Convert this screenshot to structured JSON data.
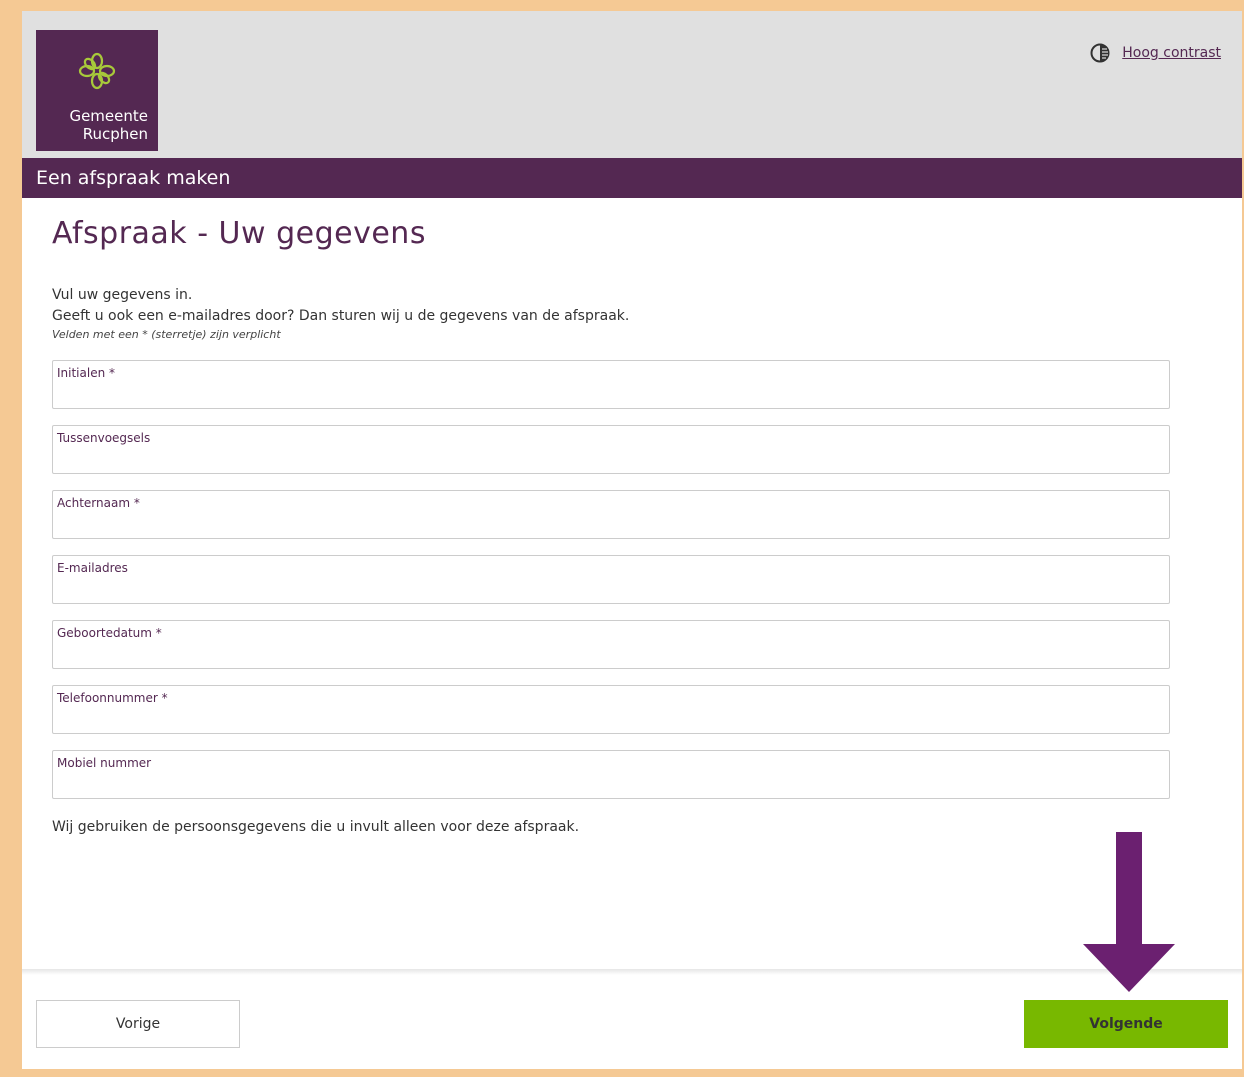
{
  "header": {
    "logo_line1": "Gemeente",
    "logo_line2": "Rucphen",
    "high_contrast_label": "Hoog contrast"
  },
  "banner": {
    "title": "Een afspraak maken"
  },
  "main": {
    "title": "Afspraak - Uw gegevens",
    "intro_line1": "Vul uw gegevens in.",
    "intro_line2": "Geeft u ook een e-mailadres door? Dan sturen wij u de gegevens van de afspraak.",
    "required_note": "Velden met een * (sterretje) zijn verplicht",
    "fields": [
      {
        "label": "Initialen *",
        "value": ""
      },
      {
        "label": "Tussenvoegsels",
        "value": ""
      },
      {
        "label": "Achternaam *",
        "value": ""
      },
      {
        "label": "E-mailadres",
        "value": ""
      },
      {
        "label": "Geboortedatum *",
        "value": ""
      },
      {
        "label": "Telefoonnummer *",
        "value": ""
      },
      {
        "label": "Mobiel nummer",
        "value": ""
      }
    ],
    "privacy_note": "Wij gebruiken de persoonsgegevens die u invult alleen voor deze afspraak."
  },
  "footer": {
    "prev_label": "Vorige",
    "next_label": "Volgende"
  },
  "colors": {
    "brand_purple": "#542852",
    "accent_green": "#78b800",
    "frame_orange": "#f5c994",
    "arrow_purple": "#6b2070"
  },
  "icons": {
    "logo": "flower-logo-icon",
    "contrast": "contrast-icon",
    "annotation": "down-arrow-icon"
  }
}
